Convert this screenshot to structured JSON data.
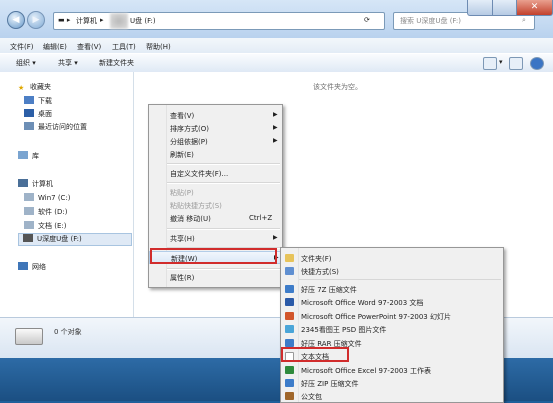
{
  "address": {
    "segment1": "计算机",
    "segment2": "U盘 (F:)",
    "search_placeholder": "搜索 U深度U盘 (F:)"
  },
  "menubar": [
    "文件(F)",
    "编辑(E)",
    "查看(V)",
    "工具(T)",
    "帮助(H)"
  ],
  "toolbar": {
    "organize": "组织 ▾",
    "share": "共享 ▾",
    "new_folder": "新建文件夹"
  },
  "nav": {
    "favorites": "收藏夹",
    "downloads": "下载",
    "desktop": "桌面",
    "recent": "最近访问的位置",
    "libraries": "库",
    "computer": "计算机",
    "win7": "Win7 (C:)",
    "software": "软件 (D:)",
    "docs": "文档 (E:)",
    "usb": "U深度U盘 (F:)",
    "network": "网络"
  },
  "content": {
    "empty_text": "该文件夹为空。"
  },
  "status": {
    "count": "0 个对象"
  },
  "context_menu": {
    "view": "查看(V)",
    "sort": "排序方式(O)",
    "group": "分组依据(P)",
    "refresh": "刷新(E)",
    "customize": "自定义文件夹(F)...",
    "paste": "粘贴(P)",
    "paste_shortcut": "粘贴快捷方式(S)",
    "undo": "撤消 移动(U)",
    "undo_shortcut": "Ctrl+Z",
    "share": "共享(H)",
    "new": "新建(W)",
    "properties": "属性(R)"
  },
  "new_submenu": {
    "folder": "文件夹(F)",
    "shortcut": "快捷方式(S)",
    "zip7": "好压 7Z 压缩文件",
    "word": "Microsoft Office Word 97-2003 文档",
    "ppt": "Microsoft Office PowerPoint 97-2003 幻灯片",
    "psd": "2345看图王 PSD 图片文件",
    "rar": "好压 RAR 压缩文件",
    "txt": "文本文档",
    "excel": "Microsoft Office Excel 97-2003 工作表",
    "zip": "好压 ZIP 压缩文件",
    "briefcase": "公文包"
  },
  "colors": {
    "highlight_border": "#d12c2c",
    "accent": "#1f5f9a"
  }
}
